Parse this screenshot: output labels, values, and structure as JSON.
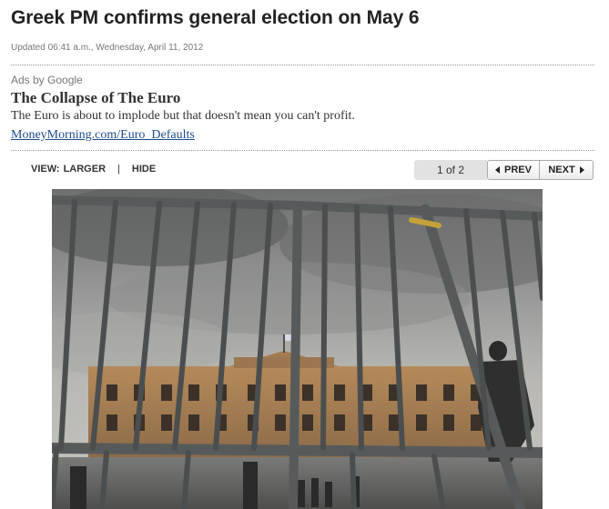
{
  "article": {
    "headline": "Greek PM confirms general election on May 6",
    "updated": "Updated 06:41 a.m., Wednesday, April 11, 2012"
  },
  "ad": {
    "label": "Ads by Google",
    "title": "The Collapse of The Euro",
    "description": "The Euro is about to implode but that doesn't mean you can't profit.",
    "link": "MoneyMorning.com/Euro_Defaults"
  },
  "gallery": {
    "view_label": "VIEW:",
    "larger": "LARGER",
    "separator": "|",
    "hide": "HIDE",
    "count": "1 of 2",
    "prev": "PREV",
    "next": "NEXT"
  },
  "colors": {
    "link": "#1a4d8c",
    "headline": "#222222",
    "muted": "#777777"
  },
  "icons": {
    "prev": "triangle-left-icon",
    "next": "triangle-right-icon"
  }
}
